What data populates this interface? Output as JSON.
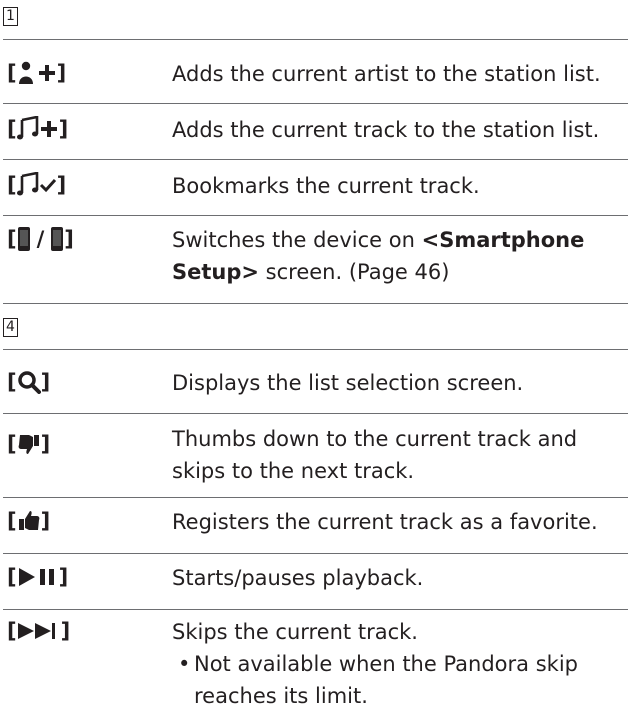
{
  "section1": {
    "box_label": "1",
    "rows": [
      {
        "key_icon": "add-artist-icon",
        "desc": "Adds the current artist to the station list."
      },
      {
        "key_icon": "add-track-icon",
        "desc": "Adds the current track to the station list."
      },
      {
        "key_icon": "bookmark-track-icon",
        "desc": "Bookmarks the current track."
      },
      {
        "key_icon": "switch-device-icon",
        "key_sep": "/",
        "desc_pre": "Switches the device on ",
        "desc_bold1": "<Smartphone",
        "desc_bold2": "Setup>",
        "desc_post": " screen. (Page 46)"
      }
    ]
  },
  "section4": {
    "box_label": "4",
    "rows": [
      {
        "key_icon": "search-icon",
        "desc": "Displays the list selection screen."
      },
      {
        "key_icon": "thumbs-down-icon",
        "desc_line1": "Thumbs down to the current track and",
        "desc_line2": "skips to the next track."
      },
      {
        "key_icon": "thumbs-up-icon",
        "desc": "Registers the current track as a favorite."
      },
      {
        "key_icon": "play-pause-icon",
        "desc": "Starts/pauses playback."
      },
      {
        "key_icon": "skip-icon",
        "desc": "Skips the current track.",
        "bullet_line1": "Not available when the Pandora skip",
        "bullet_line2": "reaches its limit.",
        "bullet_mark": "•"
      }
    ]
  },
  "colors": {
    "text": "#231f20",
    "rule": "#6d6e71"
  }
}
